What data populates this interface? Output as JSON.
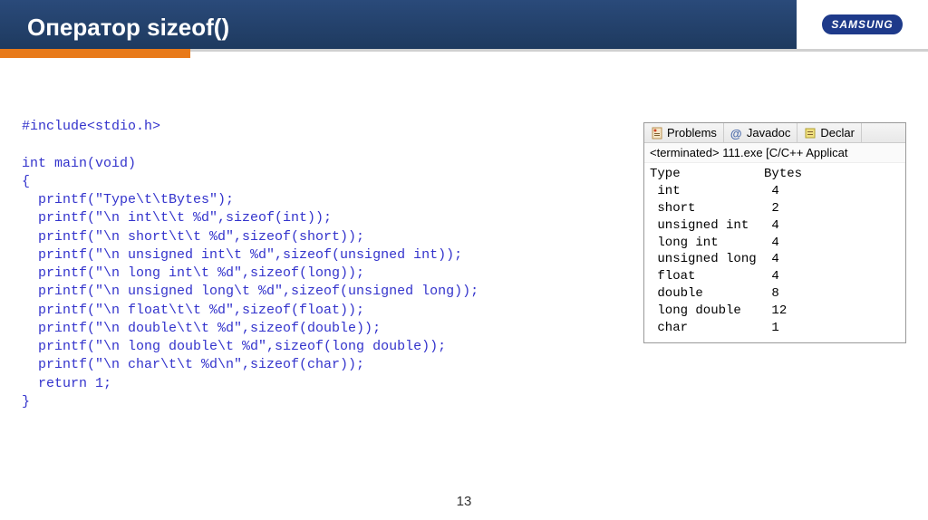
{
  "header": {
    "title": "Оператор sizeof()",
    "logo": "SAMSUNG"
  },
  "code": "#include<stdio.h>\n\nint main(void)\n{\n  printf(\"Type\\t\\tBytes\");\n  printf(\"\\n int\\t\\t %d\",sizeof(int));\n  printf(\"\\n short\\t\\t %d\",sizeof(short));\n  printf(\"\\n unsigned int\\t %d\",sizeof(unsigned int));\n  printf(\"\\n long int\\t %d\",sizeof(long));\n  printf(\"\\n unsigned long\\t %d\",sizeof(unsigned long));\n  printf(\"\\n float\\t\\t %d\",sizeof(float));\n  printf(\"\\n double\\t\\t %d\",sizeof(double));\n  printf(\"\\n long double\\t %d\",sizeof(long double));\n  printf(\"\\n char\\t\\t %d\\n\",sizeof(char));\n  return 1;\n}",
  "output_tabs": {
    "problems": "Problems",
    "javadoc": "Javadoc",
    "declaration": "Declar"
  },
  "output_status": "<terminated> 111.exe [C/C++ Applicat",
  "output_body": "Type           Bytes\n int            4\n short          2\n unsigned int   4\n long int       4\n unsigned long  4\n float          4\n double         8\n long double    12\n char           1",
  "page_number": "13"
}
